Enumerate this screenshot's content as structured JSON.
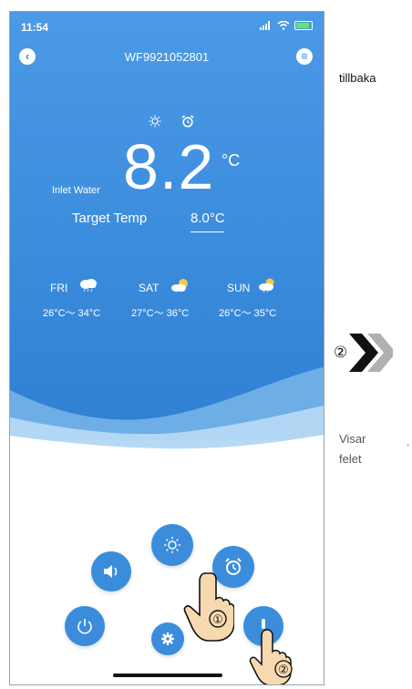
{
  "status": {
    "time": "11:54"
  },
  "header": {
    "title": "WF9921052801"
  },
  "main": {
    "inlet_label": "Inlet Water",
    "inlet_temp": "8.2",
    "unit": "°C",
    "target_label": "Target Temp",
    "target_value": "8.0°C"
  },
  "weather": [
    {
      "day": "FRI",
      "range": "26°C～ 34°C",
      "icon": "rain-cloud-icon"
    },
    {
      "day": "SAT",
      "range": "27°C～ 36°C",
      "icon": "sun-cloud-icon"
    },
    {
      "day": "SUN",
      "range": "26°C～ 35°C",
      "icon": "sun-rain-icon"
    }
  ],
  "annotations": {
    "step1": "①",
    "step2": "②",
    "step2_side": "②",
    "tillbaka": "tillbaka",
    "visar": "Visar",
    "felet": "felet",
    "dot": "."
  },
  "colors": {
    "accent": "#3b8ddc",
    "hero_top": "#4a9ae6",
    "hero_bottom": "#2f7fd3"
  }
}
